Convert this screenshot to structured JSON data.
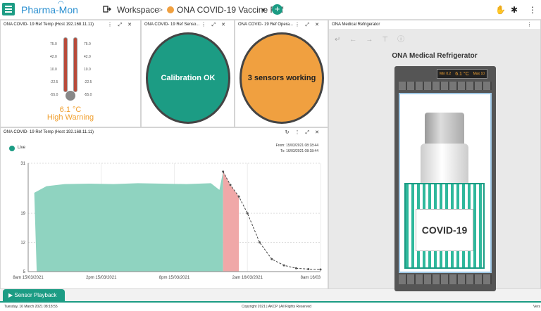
{
  "topbar": {
    "app_name": "Pharma-Mon",
    "breadcrumb_workspace": "Workspace",
    "breadcrumb_sep": ">",
    "breadcrumb_current": "ONA COVID-19 Vaccine Ref",
    "add_label": "+",
    "icons": [
      "menu-icon",
      "workspace-icon",
      "add-icon",
      "user-icon",
      "settings-icon",
      "more-icon"
    ]
  },
  "thermometer_panel": {
    "title": "ONA COVID- 19 Ref Temp (Host 192.168.11.11)",
    "scale": [
      "75.0",
      "42.0",
      "10.0",
      "-22.5",
      "-55.0"
    ],
    "value": "6.1 °C",
    "status": "High Warning"
  },
  "sensor_panel": {
    "title": "ONA COVID- 19 Ref Senso...",
    "text": "Calibration OK",
    "color": "#1c9c84"
  },
  "operation_panel": {
    "title": "ONA COVID- 19 Ref Opera...",
    "text": "3 sensors working",
    "color": "#f0a040"
  },
  "chart_panel": {
    "title": "ONA COVID- 19 Ref Temp (Host 192.168.11.11)",
    "legend": "Live",
    "from": "From: 15/03/2021 08:18:44",
    "to": "To: 16/03/2021 08:18:44"
  },
  "chart_data": {
    "type": "area",
    "series": [
      {
        "values": [
          19,
          23.9,
          25.5,
          26,
          26.1,
          26,
          26.2,
          26.1,
          26,
          26.2,
          24.6,
          29,
          25.8,
          23,
          19,
          12,
          8,
          6.5,
          5.8,
          5.6,
          5.5
        ]
      }
    ],
    "x": [
      0,
      0.5,
      1.5,
      3,
      5,
      7,
      9,
      11,
      13,
      15,
      15.7,
      16,
      16.6,
      17.3,
      18,
      19,
      20,
      21,
      22,
      23,
      24
    ],
    "xticks": [
      "8am 15/03/2021",
      "2pm 15/03/2021",
      "8pm 15/03/2021",
      "2am 16/03/2021",
      "8am 16/03"
    ],
    "yticks": [
      "31",
      "19",
      "12",
      "5"
    ],
    "ylim": [
      5,
      31
    ],
    "colors": {
      "normal": "#8fd3c0",
      "warning": "#f0a8a8",
      "line": "#444444"
    }
  },
  "fridge_panel": {
    "title": "ONA Medical Refrigerator",
    "heading": "ONA Medical Refrigerator",
    "display": [
      "Min 0.2",
      "6.1 °C",
      "Max 10"
    ],
    "vial_label": "COVID-19"
  },
  "statusbar": {
    "date": "Tuesday, 16 March 2021 08:18:55",
    "copyright": "Copyright 2021 | AKCP | All Rights Reserved",
    "version": "Vers",
    "playback_label": "Sensor Playback"
  }
}
